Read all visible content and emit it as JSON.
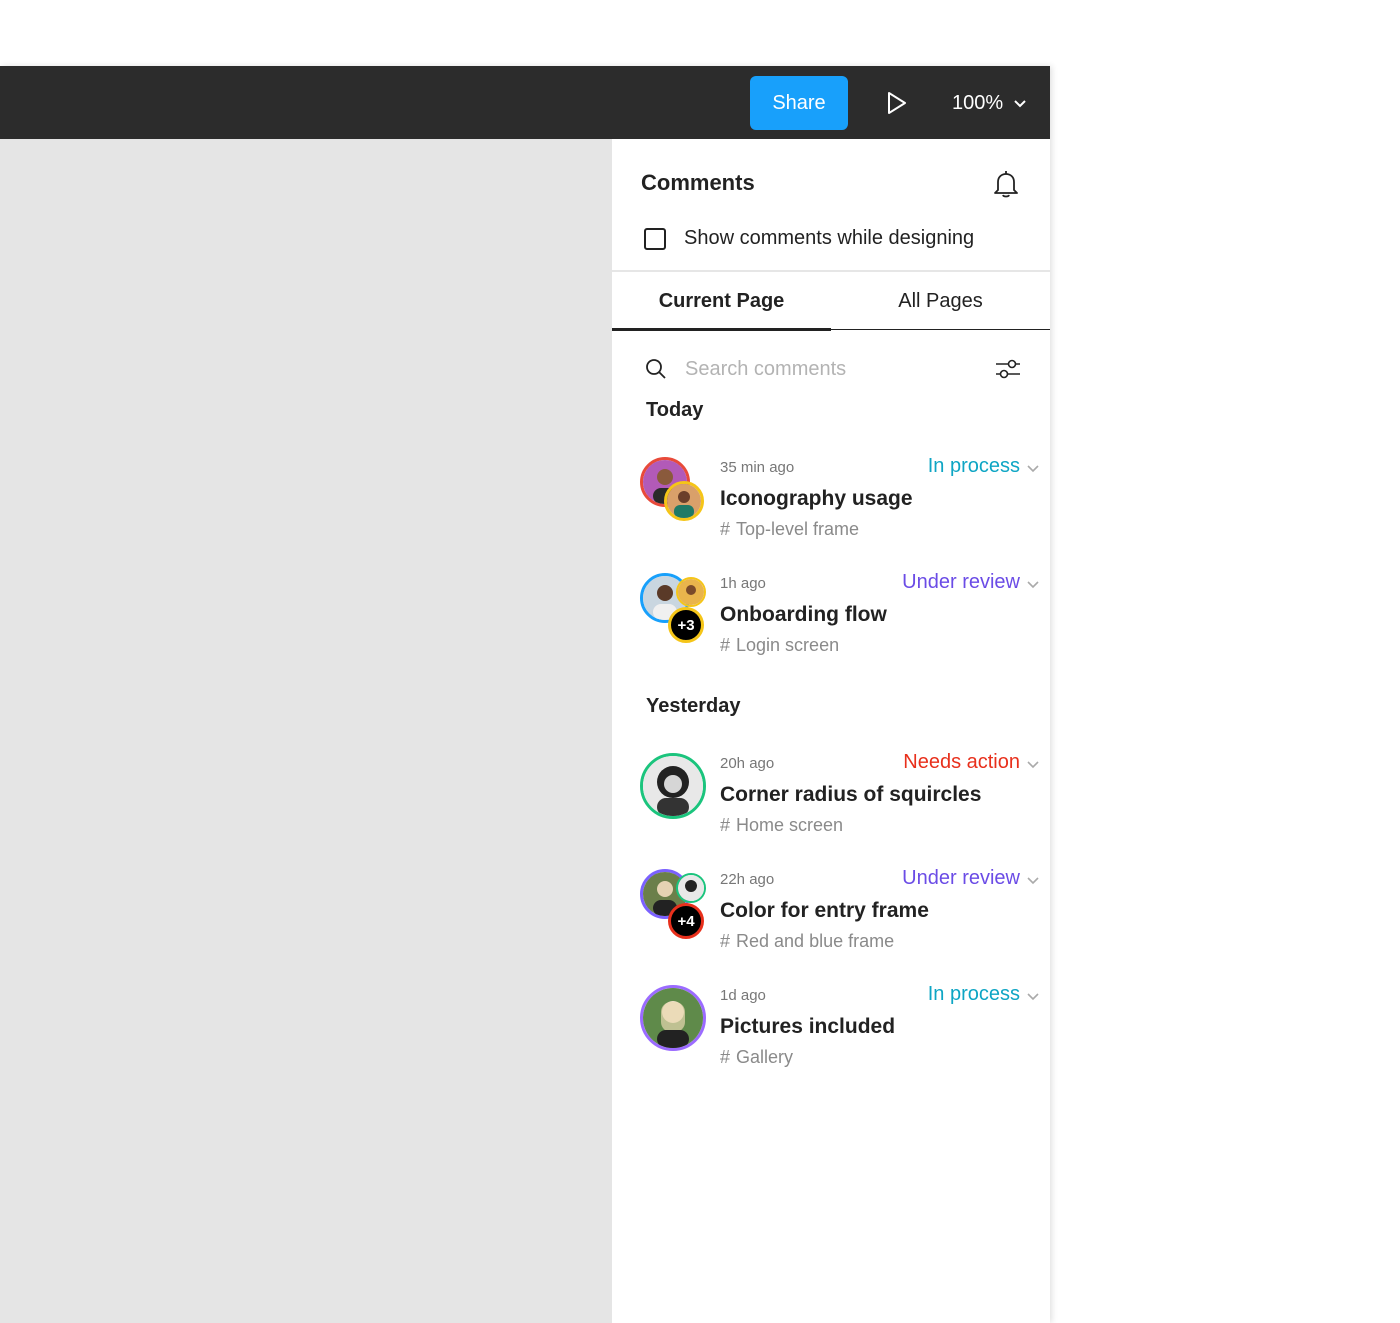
{
  "toolbar": {
    "share_label": "Share",
    "zoom_label": "100%",
    "bg_color": "#2c2c2c",
    "share_color": "#18a0fb"
  },
  "panel": {
    "title": "Comments",
    "show_comments_label": "Show comments while designing",
    "tabs": [
      {
        "label": "Current Page",
        "active": true
      },
      {
        "label": "All Pages",
        "active": false
      }
    ],
    "search_placeholder": "Search comments"
  },
  "status_colors": {
    "in_process": "#0ea5c4",
    "under_review": "#6b4ce6",
    "needs_action": "#e8301c"
  },
  "sections": [
    {
      "label": "Today",
      "comments": [
        {
          "time": "35 min ago",
          "status": "In process",
          "status_key": "in_process",
          "title": "Iconography usage",
          "frame": "Top-level frame",
          "frame_icon": "hash-icon"
        },
        {
          "time": "1h ago",
          "status": "Under review",
          "status_key": "under_review",
          "title": "Onboarding flow",
          "frame": "Login screen",
          "frame_icon": "hash-icon",
          "extra": "+3"
        }
      ]
    },
    {
      "label": "Yesterday",
      "comments": [
        {
          "time": "20h ago",
          "status": "Needs action",
          "status_key": "needs_action",
          "title": "Corner radius of squircles",
          "frame": "Home screen",
          "frame_icon": "hash-icon"
        },
        {
          "time": "22h ago",
          "status": "Under review",
          "status_key": "under_review",
          "title": "Color for entry frame",
          "frame": "Red and blue frame",
          "frame_icon": "hash-icon",
          "extra": "+4"
        },
        {
          "time": "1d ago",
          "status": "In process",
          "status_key": "in_process",
          "title": "Pictures included",
          "frame": "Gallery",
          "frame_icon": "hash-icon"
        }
      ]
    }
  ]
}
